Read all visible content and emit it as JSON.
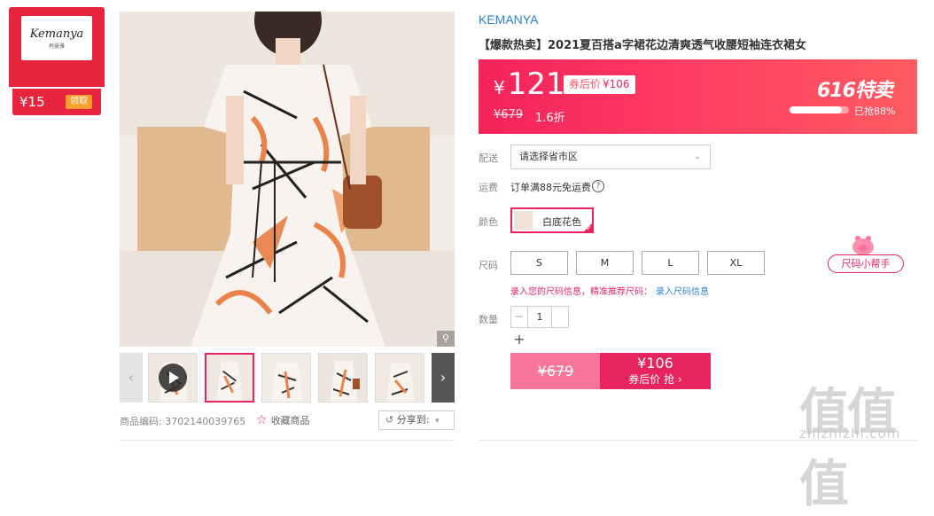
{
  "coupon": {
    "logo_text": "Kemanya",
    "logo_sub": "柯曼雅",
    "amount": "¥15",
    "claim_label": "领取"
  },
  "gallery": {
    "zoom_icon": "magnifier-icon",
    "prev_icon": "chevron-left-icon",
    "next_icon": "chevron-right-icon",
    "thumbnails": [
      "video",
      "image",
      "image",
      "image",
      "image",
      "image"
    ],
    "active_index": 1
  },
  "meta": {
    "sku_label": "商品编码:",
    "sku_value": "3702140039765",
    "favorite_label": "收藏商品",
    "share_label": "分享到:"
  },
  "product": {
    "brand": "KEMANYA",
    "title": "【爆款热卖】2021夏百搭a字裙花边清爽透气收腰短袖连衣裙女"
  },
  "price": {
    "currency": "¥",
    "current": "121",
    "after_coupon_label": "券后价",
    "after_coupon_value": "¥106",
    "original": "¥679",
    "discount": "1.6折",
    "promo_title": "616特卖",
    "sold_text": "已抢88%",
    "sold_fraction": 0.88
  },
  "delivery": {
    "label": "配送",
    "placeholder": "请选择省市区"
  },
  "shipping": {
    "label": "运费",
    "text": "订单满88元免运费"
  },
  "color": {
    "label": "颜色",
    "options": [
      "白底花色"
    ]
  },
  "size": {
    "label": "尺码",
    "options": [
      "S",
      "M",
      "L",
      "XL"
    ],
    "helper": "尺码小帮手",
    "hint": "录入您的尺码信息，精准推荐尺码：",
    "hint_link": "录入尺码信息"
  },
  "quantity": {
    "label": "数量",
    "value": "1",
    "minus": "−",
    "plus": "+"
  },
  "buy": {
    "original_price": "¥679",
    "coupon_price": "¥106",
    "coupon_action": "券后价 抢 ›"
  },
  "watermark": {
    "title": "值值值",
    "url": "zhizhizhi.com"
  },
  "colors": {
    "accent": "#e7245e",
    "brand_blue": "#2c7fd2",
    "coupon_red": "#e7243e"
  }
}
